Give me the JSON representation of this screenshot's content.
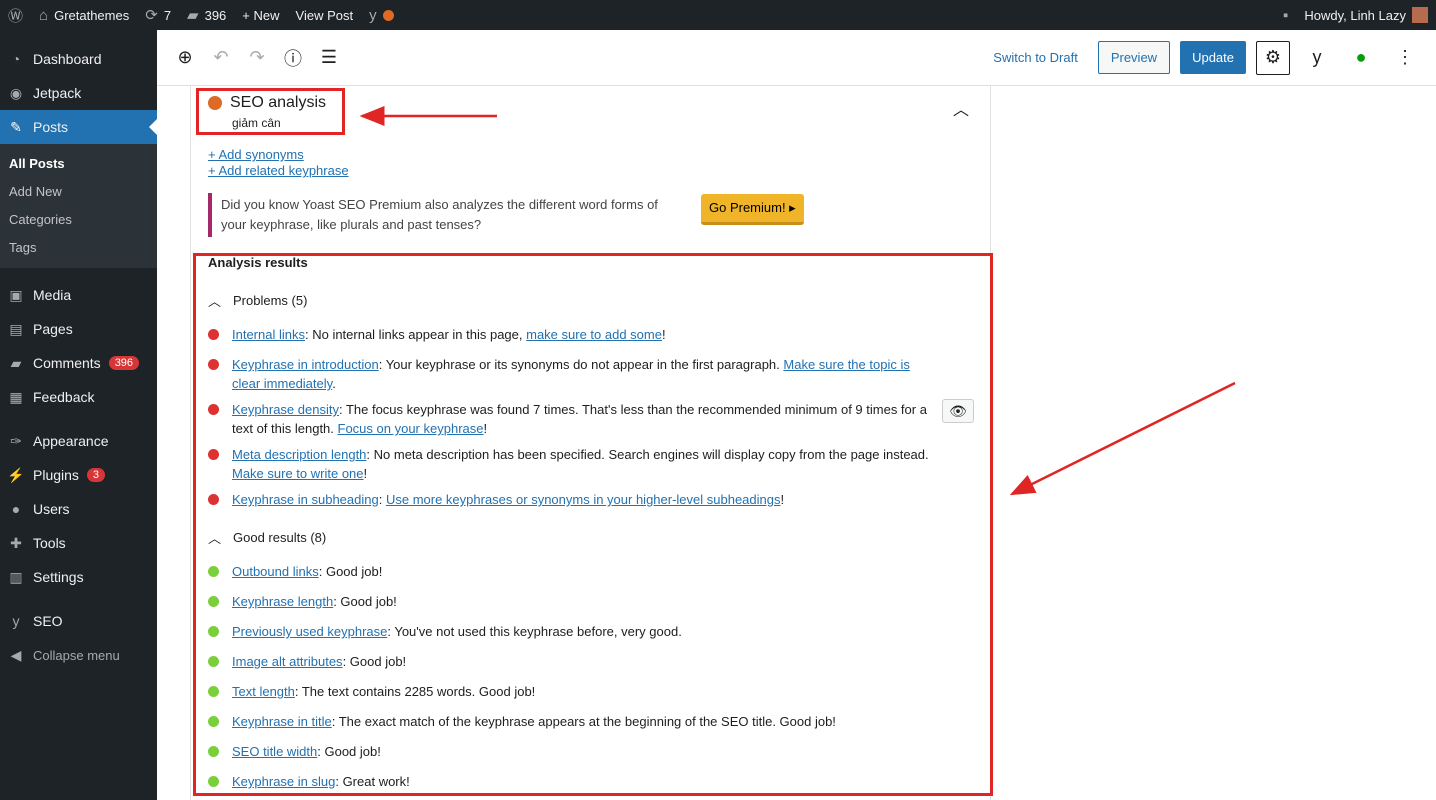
{
  "adminbar": {
    "site": "Gretathemes",
    "updates": "7",
    "comments": "396",
    "new": "+ New",
    "view_post": "View Post",
    "howdy": "Howdy, Linh Lazy"
  },
  "sidebar": {
    "items": [
      {
        "label": "Dashboard",
        "icon": "dashboard-icon"
      },
      {
        "label": "Jetpack",
        "icon": "jetpack-icon"
      },
      {
        "label": "Posts",
        "icon": "pin-icon"
      },
      {
        "label": "Media",
        "icon": "media-icon"
      },
      {
        "label": "Pages",
        "icon": "pages-icon"
      },
      {
        "label": "Comments",
        "icon": "comments-icon",
        "badge": "396"
      },
      {
        "label": "Feedback",
        "icon": "feedback-icon"
      },
      {
        "label": "Appearance",
        "icon": "appearance-icon"
      },
      {
        "label": "Plugins",
        "icon": "plugins-icon",
        "badge": "3"
      },
      {
        "label": "Users",
        "icon": "users-icon"
      },
      {
        "label": "Tools",
        "icon": "tools-icon"
      },
      {
        "label": "Settings",
        "icon": "settings-icon"
      },
      {
        "label": "SEO",
        "icon": "yoast-icon"
      },
      {
        "label": "Collapse menu",
        "icon": "collapse-icon"
      }
    ],
    "posts_sub": [
      "All Posts",
      "Add New",
      "Categories",
      "Tags"
    ]
  },
  "header": {
    "switch_draft": "Switch to Draft",
    "preview": "Preview",
    "update": "Update"
  },
  "seo": {
    "title": "SEO analysis",
    "keyphrase": "giảm cân",
    "add_synonyms": "+ Add synonyms",
    "add_related": "+ Add related keyphrase",
    "promo": "Did you know Yoast SEO Premium also analyzes the different word forms of your keyphrase, like plurals and past tenses?",
    "go_premium": "Go Premium! ▸",
    "analysis_results": "Analysis results",
    "problems_label": "Problems (5)",
    "good_label": "Good results (8)",
    "problems": [
      {
        "link": "Internal links",
        "text": ": No internal links appear in this page, ",
        "link2": "make sure to add some",
        "end": "!"
      },
      {
        "link": "Keyphrase in introduction",
        "text": ": Your keyphrase or its synonyms do not appear in the first paragraph. ",
        "link2": "Make sure the topic is clear immediately",
        "end": "."
      },
      {
        "link": "Keyphrase density",
        "text": ": The focus keyphrase was found 7 times. That's less than the recommended minimum of 9 times for a text of this length. ",
        "link2": "Focus on your keyphrase",
        "end": "!"
      },
      {
        "link": "Meta description length",
        "text": ": No meta description has been specified. Search engines will display copy from the page instead. ",
        "link2": "Make sure to write one",
        "end": "!"
      },
      {
        "link": "Keyphrase in subheading",
        "text": ": ",
        "link2": "Use more keyphrases or synonyms in your higher-level subheadings",
        "end": "!"
      }
    ],
    "good": [
      {
        "link": "Outbound links",
        "text": ": Good job!"
      },
      {
        "link": "Keyphrase length",
        "text": ": Good job!"
      },
      {
        "link": "Previously used keyphrase",
        "text": ": You've not used this keyphrase before, very good."
      },
      {
        "link": "Image alt attributes",
        "text": ": Good job!"
      },
      {
        "link": "Text length",
        "text": ": The text contains 2285 words. Good job!"
      },
      {
        "link": "Keyphrase in title",
        "text": ": The exact match of the keyphrase appears at the beginning of the SEO title. Good job!"
      },
      {
        "link": "SEO title width",
        "text": ": Good job!"
      },
      {
        "link": "Keyphrase in slug",
        "text": ": Great work!"
      }
    ]
  },
  "colors": {
    "problem": "#dc3232",
    "good": "#7ad03a",
    "accent": "#2271b1",
    "annotation": "#e02525"
  }
}
